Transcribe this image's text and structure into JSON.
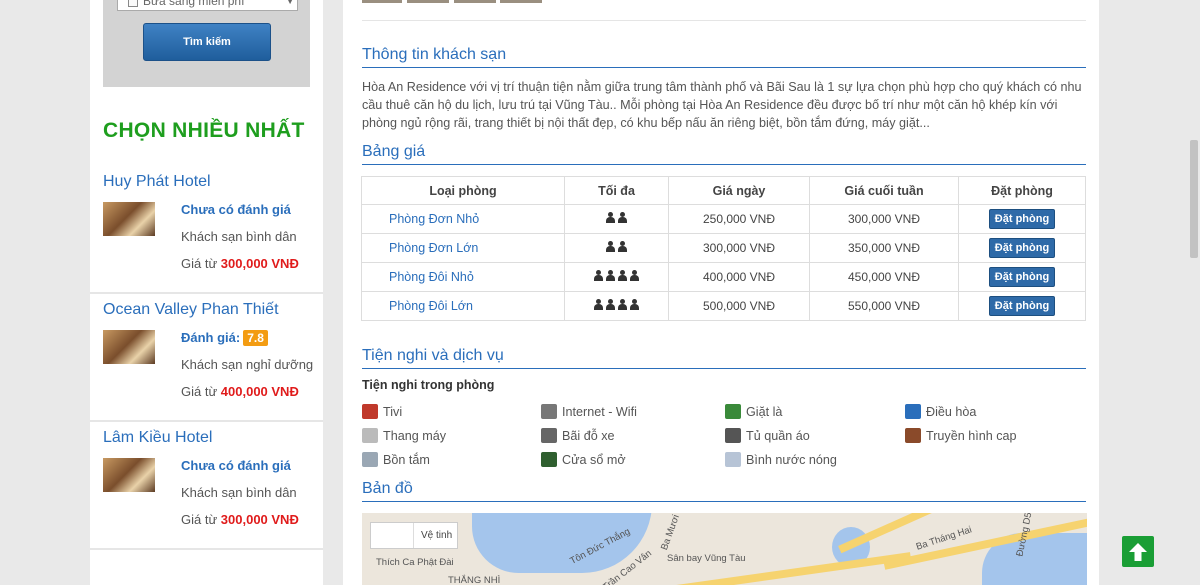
{
  "search": {
    "breakfast_label": "Bữa sáng miễn phí",
    "search_button": "Tìm kiếm"
  },
  "sidebar": {
    "title": "CHỌN NHIỀU NHẤT",
    "hotels": [
      {
        "name": "Huy Phát Hotel",
        "rating_text": "Chưa có đánh giá",
        "score": "",
        "type": "Khách sạn bình dân",
        "price_prefix": "Giá từ",
        "price": "300,000 VNĐ"
      },
      {
        "name": "Ocean Valley Phan Thiết",
        "rating_text": "Đánh giá:",
        "score": "7.8",
        "type": "Khách sạn nghỉ dưỡng",
        "price_prefix": "Giá từ",
        "price": "400,000 VNĐ"
      },
      {
        "name": "Lâm Kiều Hotel",
        "rating_text": "Chưa có đánh giá",
        "score": "",
        "type": "Khách sạn bình dân",
        "price_prefix": "Giá từ",
        "price": "300,000 VNĐ"
      }
    ]
  },
  "main": {
    "info_title": "Thông tin khách sạn",
    "info_text": "Hòa An Residence với vị trí thuận tiện nằm giữa trung tâm thành phố và Bãi Sau là 1 sự lựa chọn phù hợp cho quý khách có nhu cầu thuê căn hộ du lịch, lưu trú tại Vũng Tàu.. Mỗi phòng tại Hòa An Residence đều được bố trí như một căn hộ khép kín với phòng ngủ rộng rãi, trang thiết bị nội thất đẹp, có khu bếp nấu ăn riêng biệt, bồn tắm đứng, máy giặt...",
    "price_title": "Bảng giá",
    "price_table": {
      "headers": [
        "Loại phòng",
        "Tối đa",
        "Giá ngày",
        "Giá cuối tuần",
        "Đặt phòng"
      ],
      "rows": [
        {
          "room": "Phòng Đơn Nhỏ",
          "max_guests": 2,
          "day_price": "250,000 VNĐ",
          "weekend_price": "300,000 VNĐ",
          "book": "Đặt phòng"
        },
        {
          "room": "Phòng Đơn Lớn",
          "max_guests": 2,
          "day_price": "300,000 VNĐ",
          "weekend_price": "350,000 VNĐ",
          "book": "Đặt phòng"
        },
        {
          "room": "Phòng Đôi Nhỏ",
          "max_guests": 4,
          "day_price": "400,000 VNĐ",
          "weekend_price": "450,000 VNĐ",
          "book": "Đặt phòng"
        },
        {
          "room": "Phòng Đôi Lớn",
          "max_guests": 4,
          "day_price": "500,000 VNĐ",
          "weekend_price": "550,000 VNĐ",
          "book": "Đặt phòng"
        }
      ]
    },
    "amenities_title": "Tiện nghi và dịch vụ",
    "amenities_sub": "Tiện nghi trong phòng",
    "amenities": [
      {
        "label": "Tivi",
        "icon": "tv-icon",
        "color": "#c0392b"
      },
      {
        "label": "Internet - Wifi",
        "icon": "wifi-icon",
        "color": "#777777"
      },
      {
        "label": "Giặt là",
        "icon": "laundry-icon",
        "color": "#3a8a3a"
      },
      {
        "label": "Điều hòa",
        "icon": "air-conditioner-icon",
        "color": "#2a6ebb"
      },
      {
        "label": "Thang máy",
        "icon": "elevator-icon",
        "color": "#bbbbbb"
      },
      {
        "label": "Bãi đỗ xe",
        "icon": "parking-icon",
        "color": "#666666"
      },
      {
        "label": "Tủ quần áo",
        "icon": "wardrobe-icon",
        "color": "#555555"
      },
      {
        "label": "Truyền hình cap",
        "icon": "cable-tv-icon",
        "color": "#8a4a2a"
      },
      {
        "label": "Bồn tắm",
        "icon": "bathtub-icon",
        "color": "#9aa7b4"
      },
      {
        "label": "Cửa sổ mở",
        "icon": "window-icon",
        "color": "#2f5f2f"
      },
      {
        "label": "Bình nước nóng",
        "icon": "water-heater-icon",
        "color": "#b7c4d6"
      }
    ],
    "map_title": "Bản đồ",
    "map": {
      "toggle_label": "Vệ tinh",
      "labels": [
        "Thích Ca Phật Đài",
        "Sân bay Vũng Tàu",
        "Ba Tháng Hai",
        "Tôn Đức Thắng",
        "Trần Cao Vân",
        "Ba Mươi",
        "Đường D5",
        "THẮNG NHÌ"
      ]
    }
  }
}
